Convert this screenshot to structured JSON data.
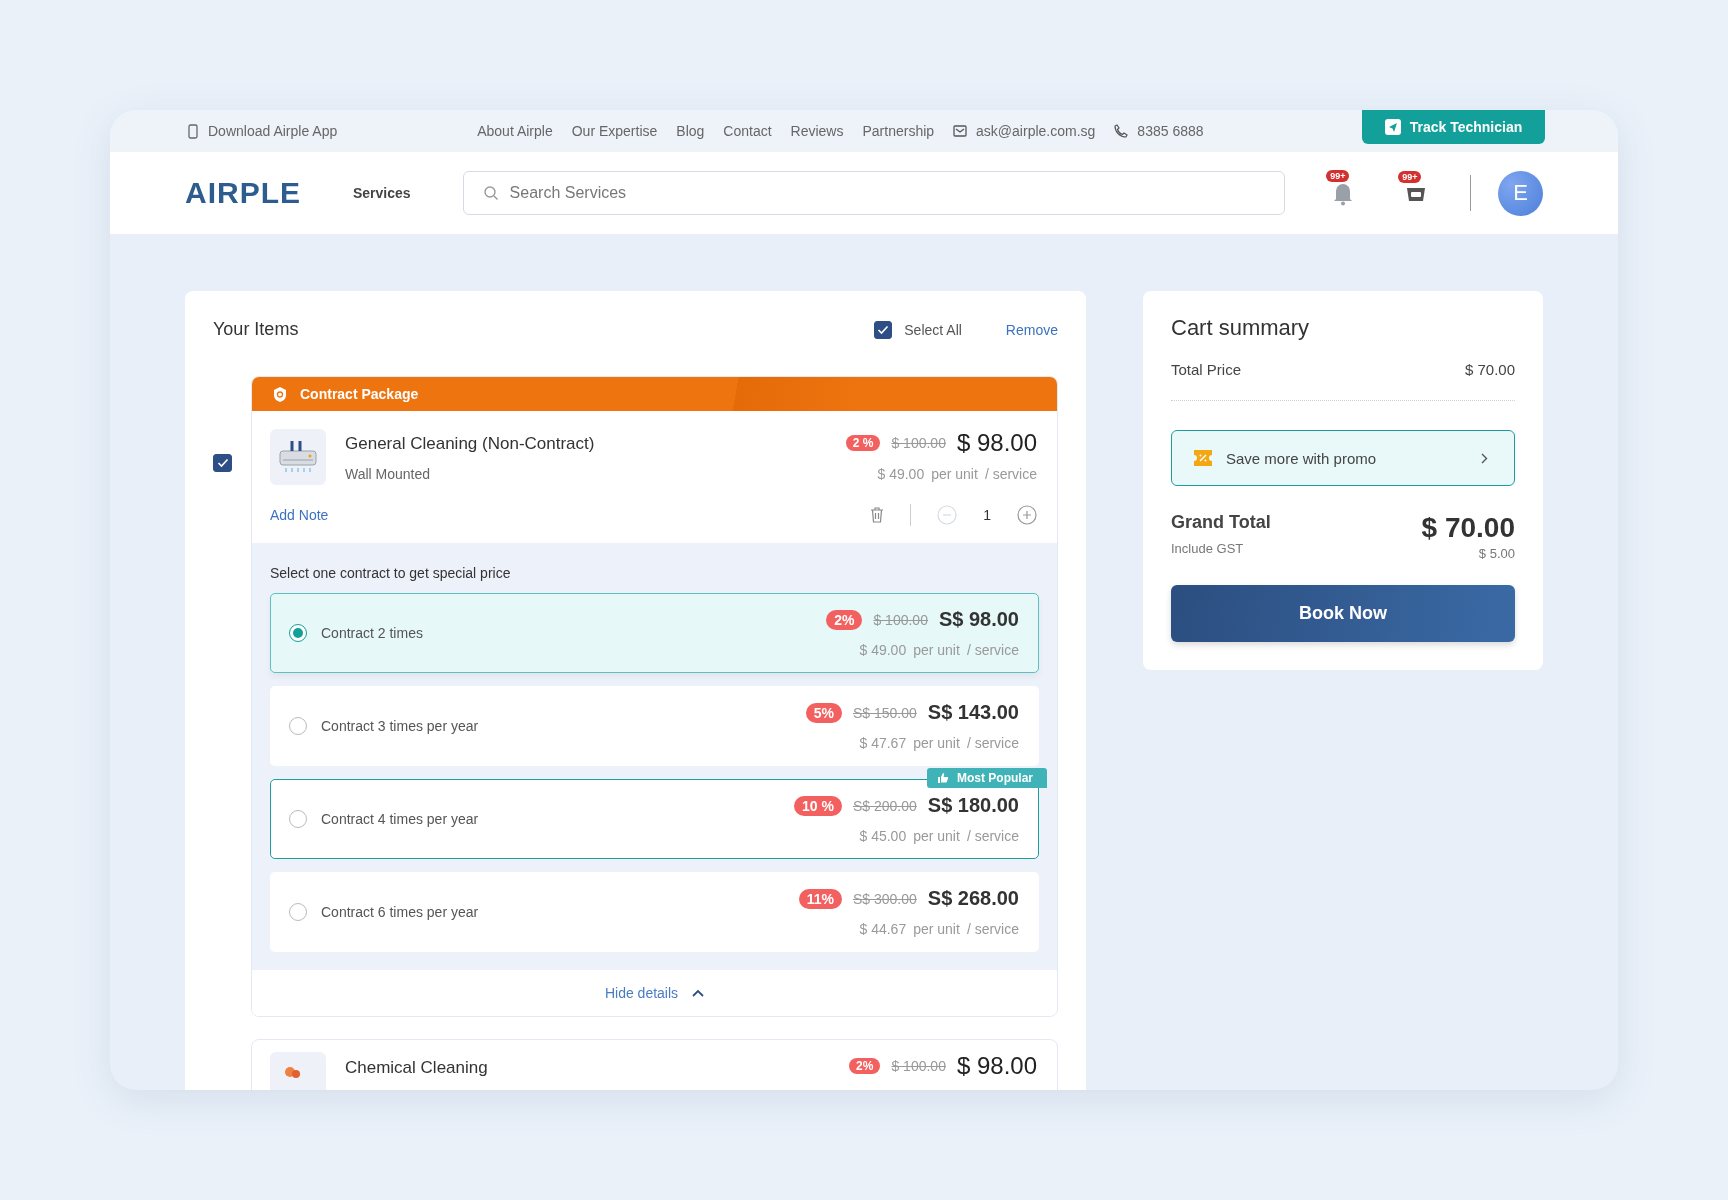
{
  "topbar": {
    "download_app": "Download Airple App",
    "links": [
      "About Airple",
      "Our Expertise",
      "Blog",
      "Contact",
      "Reviews",
      "Partnership"
    ],
    "email": "ask@airple.com.sg",
    "phone": "8385 6888",
    "track_button": "Track Technician"
  },
  "header": {
    "logo": "AIRPLE",
    "services": "Services",
    "search": {
      "placeholder": "Search Services"
    },
    "notification_badge": "99+",
    "cart_badge": "99+",
    "avatar": "E"
  },
  "items": {
    "title": "Your Items",
    "select_all": {
      "label": "Select All",
      "checked": true
    },
    "remove": "Remove",
    "package": {
      "banner": "Contract Package",
      "item": {
        "checked": true,
        "name": "General Cleaning (Non-Contract)",
        "variant": "Wall Mounted",
        "discount": "2 %",
        "old_price": "$ 100.00",
        "price": "$ 98.00",
        "unit_price": "$ 49.00",
        "unit_label": "per unit",
        "per_service": "/ service",
        "add_note": "Add Note",
        "quantity": "1"
      },
      "prompt": "Select one contract to get special price",
      "contracts": [
        {
          "label": "Contract 2 times",
          "selected": true,
          "discount": "2%",
          "old_price": "$ 100.00",
          "price": "S$ 98.00",
          "unit_price": "$ 49.00",
          "unit_label": "per unit",
          "per_service": "/ service"
        },
        {
          "label": "Contract 3 times per year",
          "selected": false,
          "discount": "5%",
          "old_price": "S$ 150.00",
          "price": "S$ 143.00",
          "unit_price": "$ 47.67",
          "unit_label": "per unit",
          "per_service": "/ service"
        },
        {
          "label": "Contract 4 times per year",
          "selected": false,
          "badge": "Most Popular",
          "discount": "10 %",
          "old_price": "S$ 200.00",
          "price": "S$ 180.00",
          "unit_price": "$ 45.00",
          "unit_label": "per unit",
          "per_service": "/ service"
        },
        {
          "label": "Contract 6 times per year",
          "selected": false,
          "discount": "11%",
          "old_price": "S$ 300.00",
          "price": "S$ 268.00",
          "unit_price": "$ 44.67",
          "unit_label": "per unit",
          "per_service": "/ service"
        }
      ],
      "hide_details": "Hide details"
    },
    "next_item": {
      "name": "Chemical Cleaning",
      "discount": "2%",
      "old_price": "$ 100.00",
      "price": "$ 98.00"
    }
  },
  "summary": {
    "title": "Cart summary",
    "total_label": "Total Price",
    "total_value": "$ 70.00",
    "promo": "Save more with promo",
    "grand_label": "Grand Total",
    "grand_value": "$ 70.00",
    "gst_label": "Include GST",
    "gst_value": "$ 5.00",
    "book_button": "Book Now"
  }
}
